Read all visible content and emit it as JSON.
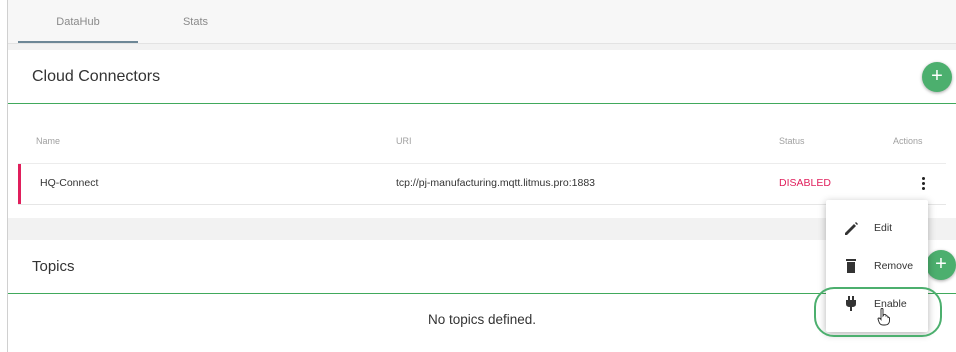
{
  "tabs": [
    {
      "label": "DataHub",
      "active": true
    },
    {
      "label": "Stats",
      "active": false
    }
  ],
  "connectors": {
    "title": "Cloud Connectors",
    "add_icon": "plus-icon",
    "columns": [
      "Name",
      "URI",
      "Status",
      "Actions"
    ],
    "rows": [
      {
        "name": "HQ-Connect",
        "uri": "tcp://pj-manufacturing.mqtt.litmus.pro:1883",
        "status": "DISABLED"
      }
    ]
  },
  "topics": {
    "title": "Topics",
    "empty_text": "No topics defined."
  },
  "menu": {
    "items": [
      {
        "label": "Edit",
        "icon": "pencil-icon"
      },
      {
        "label": "Remove",
        "icon": "trash-icon"
      },
      {
        "label": "Enable",
        "icon": "plug-icon"
      }
    ]
  },
  "colors": {
    "accent_green": "#4caf6e",
    "status_disabled": "#e01f5c",
    "tab_indicator": "#6d8796"
  }
}
